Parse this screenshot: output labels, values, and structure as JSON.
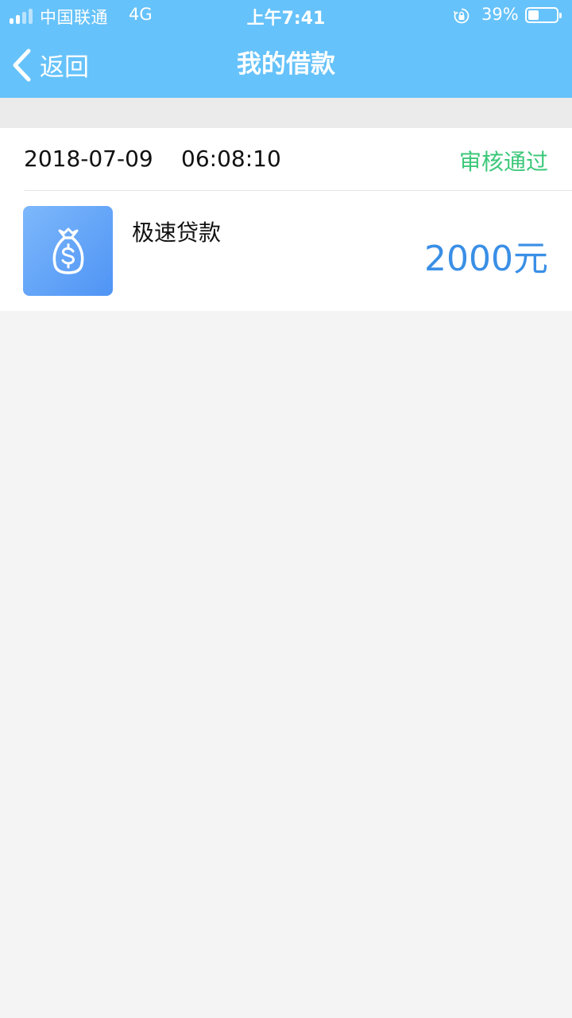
{
  "status_bar": {
    "carrier": "中国联通",
    "network": "4G",
    "time": "上午7:41",
    "battery_percent": "39%",
    "battery_level": 0.39,
    "icons": [
      "signal-icon",
      "orientation-lock-icon",
      "battery-icon"
    ]
  },
  "nav": {
    "back_label": "返回",
    "title": "我的借款"
  },
  "loan": {
    "date": "2018-07-09",
    "time": "06:08:10",
    "status": "审核通过",
    "product_name": "极速贷款",
    "amount": "2000元",
    "icon": "money-bag-icon"
  },
  "colors": {
    "header": "#66c2fa",
    "status_approved": "#3cc87a",
    "amount": "#3a8fe6",
    "icon_bg_start": "#7db8fb",
    "icon_bg_end": "#4f94f5",
    "page_bg": "#f4f4f4"
  }
}
